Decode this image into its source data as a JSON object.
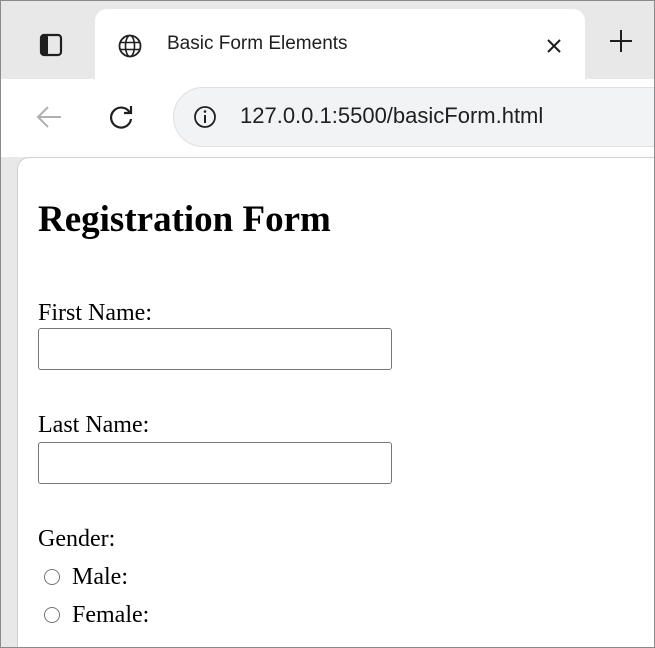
{
  "browser": {
    "tab": {
      "title": "Basic Form Elements",
      "favicon": "globe-icon"
    },
    "address_bar": {
      "url": "127.0.0.1:5500/basicForm.html"
    }
  },
  "page": {
    "heading": "Registration Form",
    "fields": {
      "first_name": {
        "label": "First Name:",
        "value": ""
      },
      "last_name": {
        "label": "Last Name:",
        "value": ""
      }
    },
    "gender": {
      "label": "Gender:",
      "options": [
        {
          "label": "Male:",
          "checked": false
        },
        {
          "label": "Female:",
          "checked": false
        }
      ]
    }
  }
}
